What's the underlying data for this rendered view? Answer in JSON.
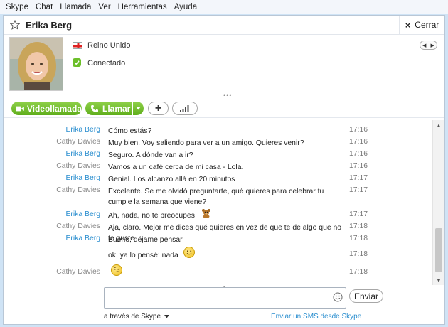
{
  "menu": [
    "Skype",
    "Chat",
    "Llamada",
    "Ver",
    "Herramientas",
    "Ayuda"
  ],
  "header": {
    "contact_name": "Erika Berg",
    "close_label": "Cerrar",
    "close_symbol": "×"
  },
  "profile": {
    "country": "Reino Unido",
    "status": "Conectado"
  },
  "call_bar": {
    "video_label": "Videollamada",
    "call_label": "Llamar"
  },
  "messages": [
    {
      "sender": "Erika Berg",
      "text": "Cómo estás?",
      "time": "17:16"
    },
    {
      "sender": "Cathy Davies",
      "text": "Muy bien. Voy saliendo para ver a un amigo. Quieres venir?",
      "time": "17:16"
    },
    {
      "sender": "Erika Berg",
      "text": "Seguro. A dónde van a ir?",
      "time": "17:16"
    },
    {
      "sender": "Cathy Davies",
      "text": "Vamos a un café cerca de mi casa - Lola.",
      "time": "17:16"
    },
    {
      "sender": "Erika Berg",
      "text": "Genial. Los alcanzo allá en 20 minutos",
      "time": "17:17"
    },
    {
      "sender": "Cathy Davies",
      "text": "Excelente. Se me olvidó preguntarte, qué quieres para celebrar tu cumple la semana que viene?",
      "time": "17:17"
    },
    {
      "sender": "Erika Berg",
      "text": "Ah, nada, no te preocupes",
      "time": "17:17",
      "emoticon": "bear-emoticon"
    },
    {
      "sender": "Cathy Davies",
      "text": "Aja, claro. Mejor me dices qué quieres en vez de que te de algo que no te guste",
      "time": "17:18"
    },
    {
      "sender": "Erika Berg",
      "text": "Bueno, déjame pensar",
      "time": "17:18"
    },
    {
      "sender": "",
      "text": "ok, ya lo pensé: nada",
      "time": "17:18",
      "emoticon": "smile-emoticon"
    },
    {
      "sender": "Cathy Davies",
      "text": "",
      "time": "17:18",
      "emoticon": "wondering-emoticon"
    }
  ],
  "composer": {
    "send_label": "Enviar",
    "via_label": "a través de Skype",
    "sms_label": "Enviar un SMS desde Skype"
  },
  "colors": {
    "accent_green": "#6cbf2a",
    "link_blue": "#2a8ecf"
  }
}
